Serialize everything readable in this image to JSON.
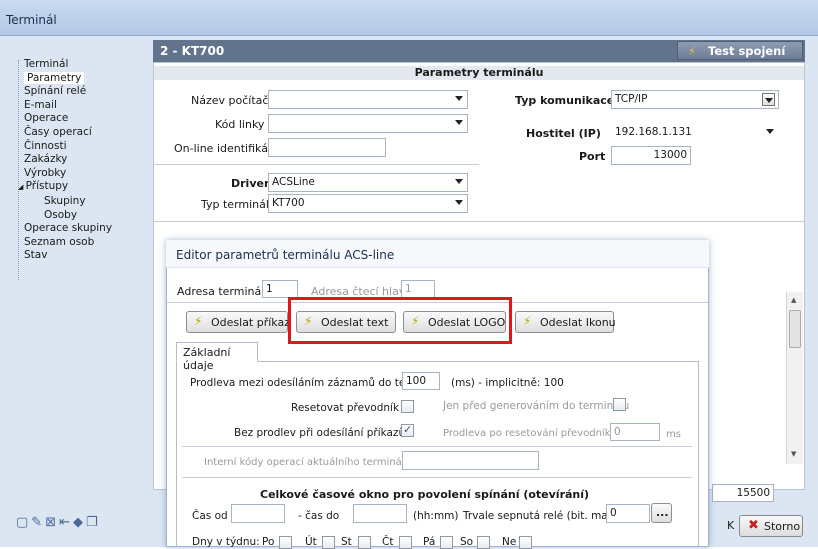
{
  "window": {
    "title": "Terminál"
  },
  "header": {
    "title": "2  -  KT700",
    "test_button": "Test spojení"
  },
  "tree": {
    "items": [
      {
        "label": "Terminál",
        "level": 0
      },
      {
        "label": "Parametry",
        "level": 0,
        "selected": true
      },
      {
        "label": "Spínání relé",
        "level": 0
      },
      {
        "label": "E-mail",
        "level": 0
      },
      {
        "label": "Operace",
        "level": 0
      },
      {
        "label": "Časy operací",
        "level": 0
      },
      {
        "label": "Činnosti",
        "level": 0
      },
      {
        "label": "Zakázky",
        "level": 0
      },
      {
        "label": "Výrobky",
        "level": 0
      },
      {
        "label": "Přístupy",
        "level": 0,
        "expanded": true
      },
      {
        "label": "Skupiny",
        "level": 1
      },
      {
        "label": "Osoby",
        "level": 1
      },
      {
        "label": "Operace skupiny",
        "level": 0
      },
      {
        "label": "Seznam osob",
        "level": 0
      },
      {
        "label": "Stav",
        "level": 0
      }
    ]
  },
  "params": {
    "section_title": "Parametry terminálu",
    "computer_name_label": "Název počítače",
    "computer_name_value": "",
    "line_code_label": "Kód linky",
    "line_code_value": "",
    "online_id_label": "On-line identifikátor",
    "online_id_value": "",
    "driver_label": "Driver",
    "driver_value": "ACSLine",
    "terminal_type_label": "Typ terminálu",
    "terminal_type_value": "KT700",
    "comm_type_label": "Typ komunikace",
    "comm_type_value": "TCP/IP",
    "host_label": "Hostitel (IP)",
    "host_value": "192.168.1.131",
    "port_label": "Port",
    "port_value": "13000",
    "port2_value": "15500"
  },
  "footer": {
    "k_label": "K",
    "cancel_button": "Storno"
  },
  "dialog": {
    "title": "Editor parametrů terminálu ACS-line",
    "terminal_address_label": "Adresa terminálu",
    "terminal_address_value": "1",
    "reader_address_label": "Adresa čtecí hlavy",
    "reader_address_value": "1",
    "buttons": {
      "send_command": "Odeslat příkaz",
      "send_text": "Odeslat text",
      "send_logo": "Odeslat LOGO",
      "send_icon": "Odeslat Ikonu"
    },
    "tab_basic": "Základní údaje",
    "delay_label": "Prodleva mezi odesíláním záznamů do term.",
    "delay_value": "100",
    "delay_note": "(ms) - implicitně: 100",
    "reset_converter_label": "Resetovat převodník",
    "only_before_gen_label": "Jen před generováním do terminálu",
    "no_delay_label": "Bez prodlev při odesílání příkazů",
    "reset_delay_label": "Prodleva po resetování převodníku",
    "reset_delay_value": "0",
    "reset_delay_unit": "ms",
    "internal_codes_label": "Interní kódy operací aktuálního terminálu",
    "internal_codes_value": "",
    "window_title": "Celkové časové okno pro povolení spínání (otevírání)",
    "time_from_label": "Čas od",
    "time_from_value": "",
    "time_to_label": "- čas do",
    "time_to_value": "",
    "time_format": "(hh:mm)",
    "relay_mask_label": "Trvale sepnutá relé (bit. maska)",
    "relay_mask_value": "0",
    "relay_mask_button": "...",
    "days_label": "Dny v týdnu:",
    "days": [
      "Po",
      "Út",
      "St",
      "Čt",
      "Pá",
      "So",
      "Ne"
    ],
    "checks": {
      "reset_converter": false,
      "only_before_gen": false,
      "no_delay": true
    }
  }
}
